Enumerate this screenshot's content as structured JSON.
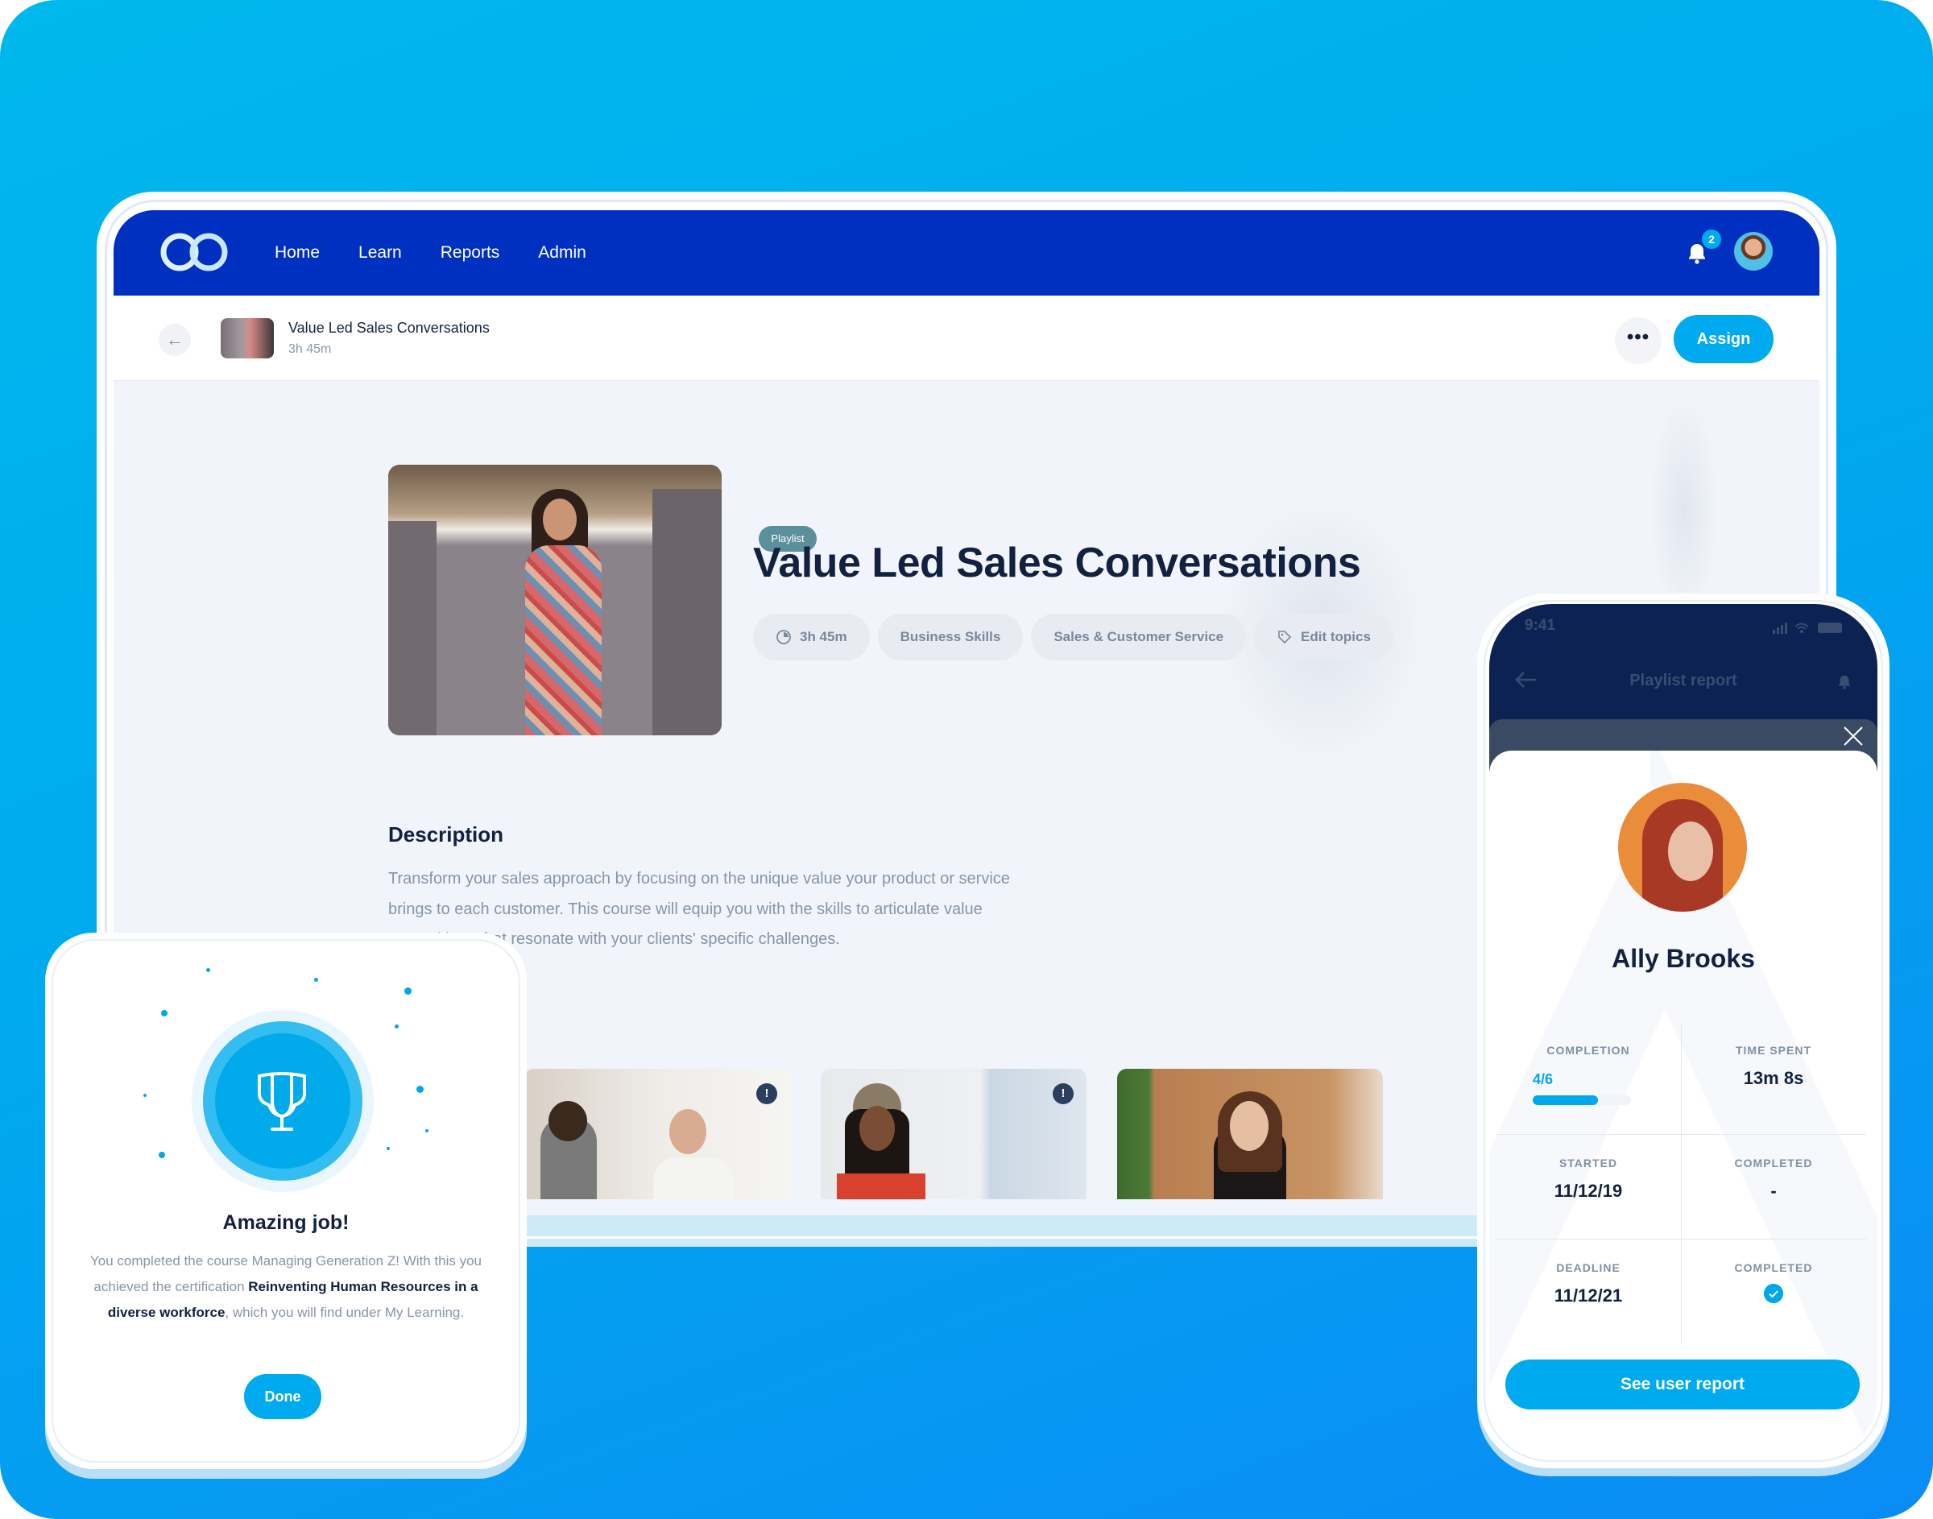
{
  "topnav": {
    "logo": "infinity-logo",
    "links": [
      "Home",
      "Learn",
      "Reports",
      "Admin"
    ],
    "notifications_count": "2"
  },
  "subbar": {
    "back": "←",
    "title": "Value Led Sales Conversations",
    "duration": "3h 45m",
    "more_label": "•••",
    "assign_label": "Assign"
  },
  "hero": {
    "badge": "Playlist",
    "title": "Value Led Sales Conversations",
    "chips": [
      {
        "icon": "clock-icon",
        "label": "3h 45m"
      },
      {
        "icon": "",
        "label": "Business Skills"
      },
      {
        "icon": "",
        "label": "Sales & Customer Service"
      },
      {
        "icon": "tag-icon",
        "label": "Edit topics"
      }
    ]
  },
  "description": {
    "heading": "Description",
    "text": "Transform your sales approach by focusing on the unique value your product or service brings to each customer. This course will equip you with the skills to articulate value propositions that resonate with your clients' specific challenges."
  },
  "carousel": {
    "cards": [
      {
        "alert": "!"
      },
      {
        "alert": "!"
      },
      {
        "alert": "!"
      },
      {
        "alert": ""
      }
    ]
  },
  "achievement": {
    "title": "Amazing job!",
    "text_before": "You completed the course Managing Generation Z! With this you achieved the certification ",
    "certification": "Reinventing Human Resources in a diverse workforce",
    "text_after": ", which you will find under My Learning.",
    "done_label": "Done"
  },
  "phone": {
    "time": "9:41",
    "header_title": "Playlist report",
    "user_name": "Ally Brooks",
    "stats": {
      "completion_label": "COMPLETION",
      "completion_value": "4/6",
      "completion_fraction": 0.6667,
      "time_spent_label": "TIME SPENT",
      "time_spent_value": "13m 8s",
      "started_label": "STARTED",
      "started_value": "11/12/19",
      "completed_label": "COMPLETED",
      "completed_value": "-",
      "deadline_label": "DEADLINE",
      "deadline_value": "11/12/21",
      "completed2_label": "COMPLETED",
      "completed2_status": "checked"
    },
    "cta_label": "See user report"
  },
  "colors": {
    "brand_navy": "#0030c0",
    "accent": "#00aaee",
    "text_dark": "#12213f",
    "text_muted": "#8795a8"
  }
}
